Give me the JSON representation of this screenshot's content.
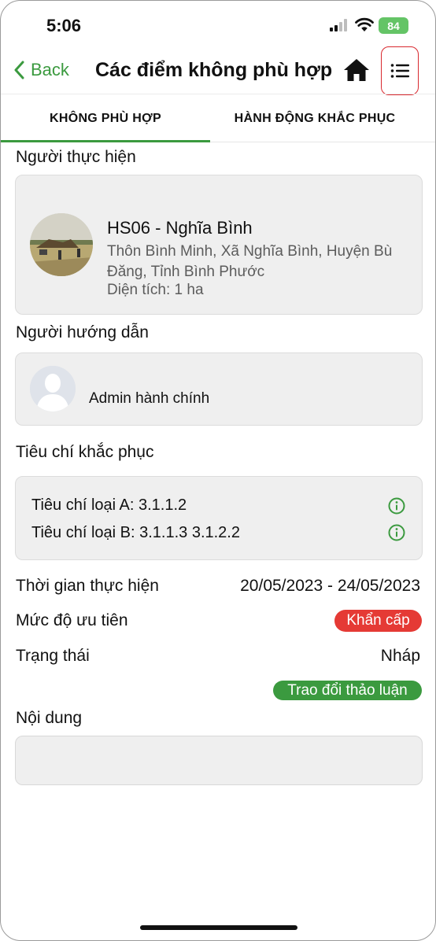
{
  "status_bar": {
    "time": "5:06",
    "battery": "84"
  },
  "navbar": {
    "back_label": "Back",
    "title": "Các điểm không phù hợp"
  },
  "tabs": [
    {
      "label": "KHÔNG PHÙ HỢP",
      "active": true
    },
    {
      "label": "HÀNH ĐỘNG KHẮC PHỤC",
      "active": false
    }
  ],
  "performer": {
    "section_label": "Người thực hiện",
    "name": "HS06 - Nghĩa Bình",
    "address": "Thôn Bình Minh, Xã Nghĩa Bình, Huyện Bù Đăng, Tỉnh Bình Phước",
    "area": "Diện tích: 1 ha"
  },
  "guide": {
    "section_label": "Người hướng dẫn",
    "name": "Admin hành chính"
  },
  "criteria": {
    "section_label": "Tiêu chí khắc phục",
    "items": [
      {
        "text": "Tiêu chí loại A: 3.1.1.2"
      },
      {
        "text": "Tiêu chí loại B: 3.1.1.3  3.1.2.2"
      }
    ]
  },
  "details": {
    "time_label": "Thời gian thực hiện",
    "time_value": "20/05/2023 - 24/05/2023",
    "priority_label": "Mức độ ưu tiên",
    "priority_value": "Khẩn cấp",
    "status_label": "Trạng thái",
    "status_value": "Nháp",
    "discussion_badge": "Trao đổi thảo luận"
  },
  "content": {
    "section_label": "Nội dung",
    "value": ""
  },
  "colors": {
    "accent_green": "#3b9a3f",
    "urgent_red": "#e53a35",
    "menu_highlight": "#d8282e",
    "card_bg": "#efefef"
  }
}
